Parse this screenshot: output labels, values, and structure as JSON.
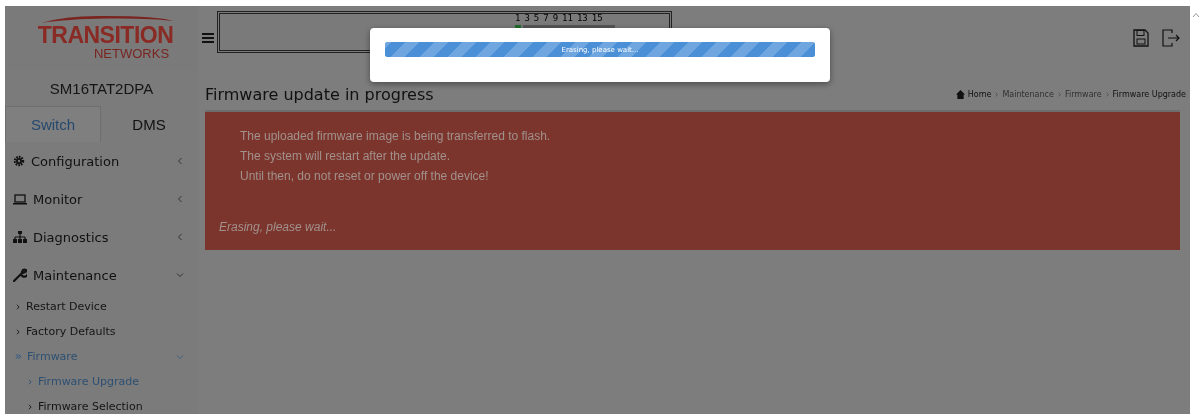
{
  "header": {
    "logo_top": "TRANSITION",
    "logo_bottom": "NETWORKS",
    "device_name": "SM16TAT2DPA",
    "port_labels": [
      "1",
      "3",
      "5",
      "7",
      "9",
      "11",
      "13",
      "15"
    ]
  },
  "tabs": [
    {
      "label": "Switch",
      "selected": true
    },
    {
      "label": "DMS",
      "selected": false
    }
  ],
  "sidebar": {
    "items": [
      {
        "label": "Configuration",
        "kind": "gear",
        "expanded": false
      },
      {
        "label": "Monitor",
        "kind": "laptop",
        "expanded": false
      },
      {
        "label": "Diagnostics",
        "kind": "sitemap",
        "expanded": false
      },
      {
        "label": "Maintenance",
        "kind": "wrench",
        "expanded": true,
        "children": [
          {
            "label": "Restart Device",
            "selected": false
          },
          {
            "label": "Factory Defaults",
            "selected": false
          },
          {
            "label": "Firmware",
            "selected": true,
            "expanded": true,
            "children": [
              {
                "label": "Firmware Upgrade",
                "selected": true
              },
              {
                "label": "Firmware Selection",
                "selected": false
              }
            ]
          }
        ]
      }
    ]
  },
  "page": {
    "title": "Firmware update in progress",
    "breadcrumb": [
      "Home",
      "Maintenance",
      "Firmware",
      "Firmware Upgrade"
    ],
    "alert_lines": [
      "The uploaded firmware image is being transferred to flash.",
      "The system will restart after the update.",
      "Until then, do not reset or power off the device!"
    ],
    "status": "Erasing, please wait..."
  },
  "dialog": {
    "progress": {
      "label": "Erasing, please wait...",
      "level": 1
    }
  }
}
